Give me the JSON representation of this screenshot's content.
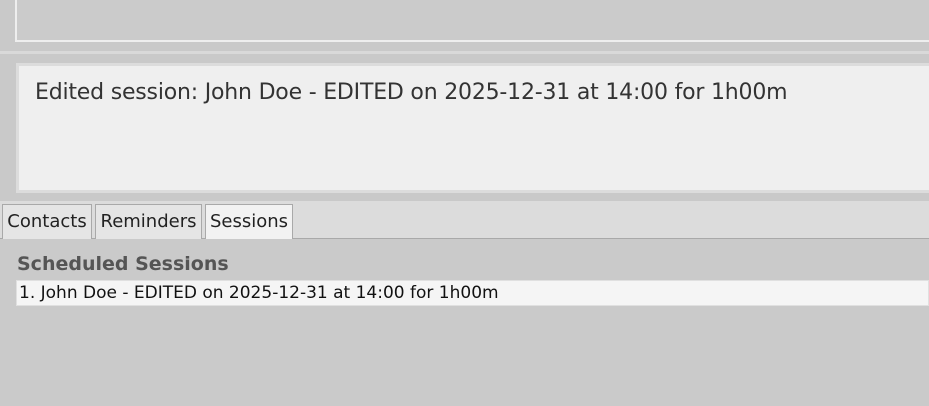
{
  "result": {
    "message": "Edited session: John Doe - EDITED on 2025-12-31 at 14:00 for 1h00m"
  },
  "tabs": [
    {
      "label": "Contacts"
    },
    {
      "label": "Reminders"
    },
    {
      "label": "Sessions",
      "active": true
    }
  ],
  "sessions_panel": {
    "title": "Scheduled Sessions",
    "items": [
      {
        "text": "1. John Doe - EDITED on 2025-12-31 at 14:00 for 1h00m"
      }
    ]
  }
}
